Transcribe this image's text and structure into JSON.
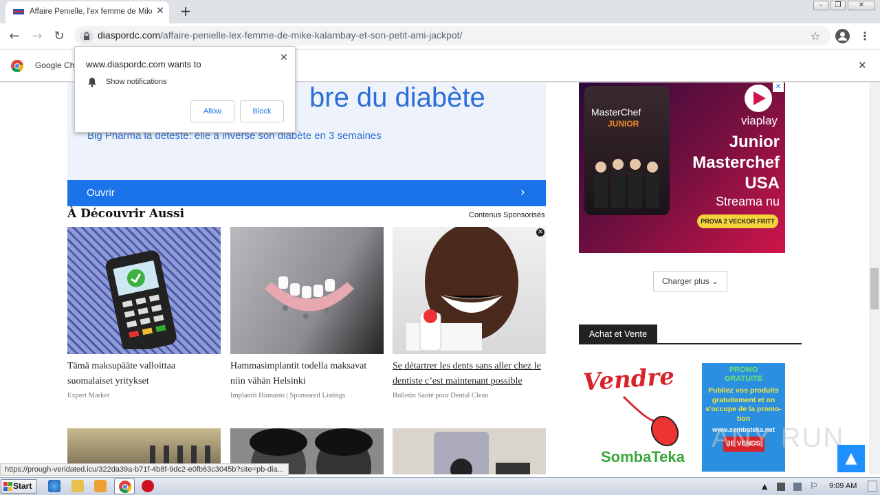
{
  "browser": {
    "tab_title": "Affaire Penielle, l'ex femme de Mike K",
    "tab_close": "✕",
    "new_tab": "+",
    "url_domain": "diaspordc.com",
    "url_path": "/affaire-penielle-lex-femme-de-mike-kalambay-et-son-petit-ami-jackpot/",
    "infobar_label": "Google Ch",
    "infobar_close": "✕",
    "window_buttons": [
      "–",
      "❐",
      "✕"
    ]
  },
  "notification_popup": {
    "title": "www.diaspordc.com wants to",
    "permission": "Show notifications",
    "allow_label": "Allow",
    "block_label": "Block",
    "close": "✕"
  },
  "ad": {
    "headline": "bre du diabète",
    "subtitle": "Big Pharma la déteste: elle a inversé son diabète en 3 semaines",
    "cta": "Ouvrir",
    "cta_arrow": "›"
  },
  "recommendations": {
    "heading": "À Découvrir Aussi",
    "sponsored_label": "Contenus Sponsorisés",
    "cards": [
      {
        "title": "Tämä maksupääte valloittaa suomalaiset yritykset",
        "source": "Expert Market"
      },
      {
        "title": "Hammasimplantit todella maksavat niin vähän Helsinki",
        "source": "Implantti Hinnasto | Sponsored Listings"
      },
      {
        "title": "Se détartrer les dents sans aller chez le dentiste c’est maintenant possible",
        "source": "Bulletin Santé pour Dental Clean"
      }
    ]
  },
  "sidebar": {
    "viaplay": {
      "brand": "viaplay",
      "show": "MasterChef",
      "show_sub": "JUNIOR",
      "line1": "Junior",
      "line2": "Masterchef",
      "line3": "USA",
      "line4": "Streama nu",
      "cta": "PROVA 2 VECKOR FRITT"
    },
    "load_more": "Charger plus",
    "section_title": "Achat et Vente",
    "sombateka": {
      "vendre": "Vendre",
      "brand": "SombaTeka",
      "promo_title": "PROMO GRATUITE",
      "promo_text": "Publiez vos produits gratuitement et on s'occupe de la promo-tion",
      "promo_url": "www.sombateka.net",
      "promo_button": "JE VENDS"
    },
    "scroll_top": "▲"
  },
  "status_url": "https://prough-veridated.icu/322da39a-b71f-4b8f-9dc2-e0fb63c3045b?site=pb-dia...",
  "taskbar": {
    "start": "Start",
    "clock": "9:09 AM"
  },
  "watermark": "ANY RUN"
}
